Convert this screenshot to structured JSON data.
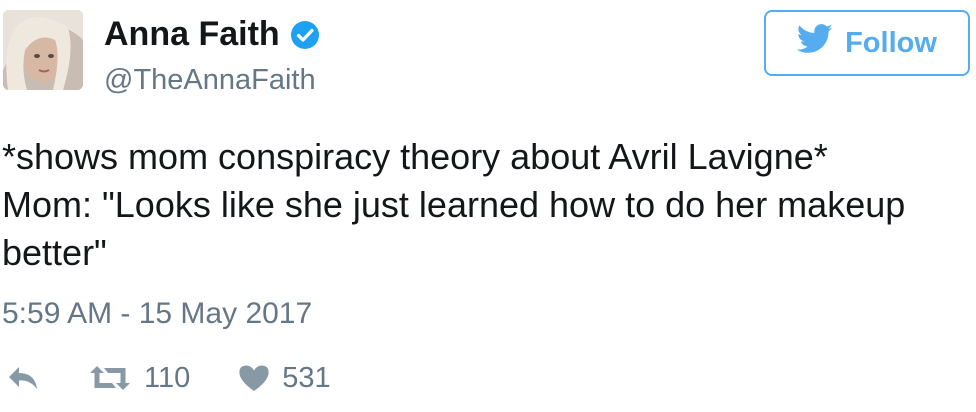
{
  "user": {
    "display_name": "Anna Faith",
    "handle": "@TheAnnaFaith",
    "verified": true,
    "avatar_icon": "profile-photo"
  },
  "follow_button": {
    "label": "Follow",
    "icon": "twitter-bird-icon"
  },
  "tweet": {
    "lines": [
      "*shows mom conspiracy theory about Avril Lavigne*",
      "Mom: \"Looks like she just learned how to do her makeup",
      "better\""
    ],
    "timestamp": "5:59 AM - 15 May 2017"
  },
  "actions": {
    "reply_icon": "reply-icon",
    "retweet_icon": "retweet-icon",
    "retweet_count": "110",
    "like_icon": "heart-icon",
    "like_count": "531"
  },
  "colors": {
    "accent": "#55acee",
    "verified": "#1da1f2",
    "text": "#14171a",
    "muted": "#657786",
    "icon": "#8899a6"
  }
}
